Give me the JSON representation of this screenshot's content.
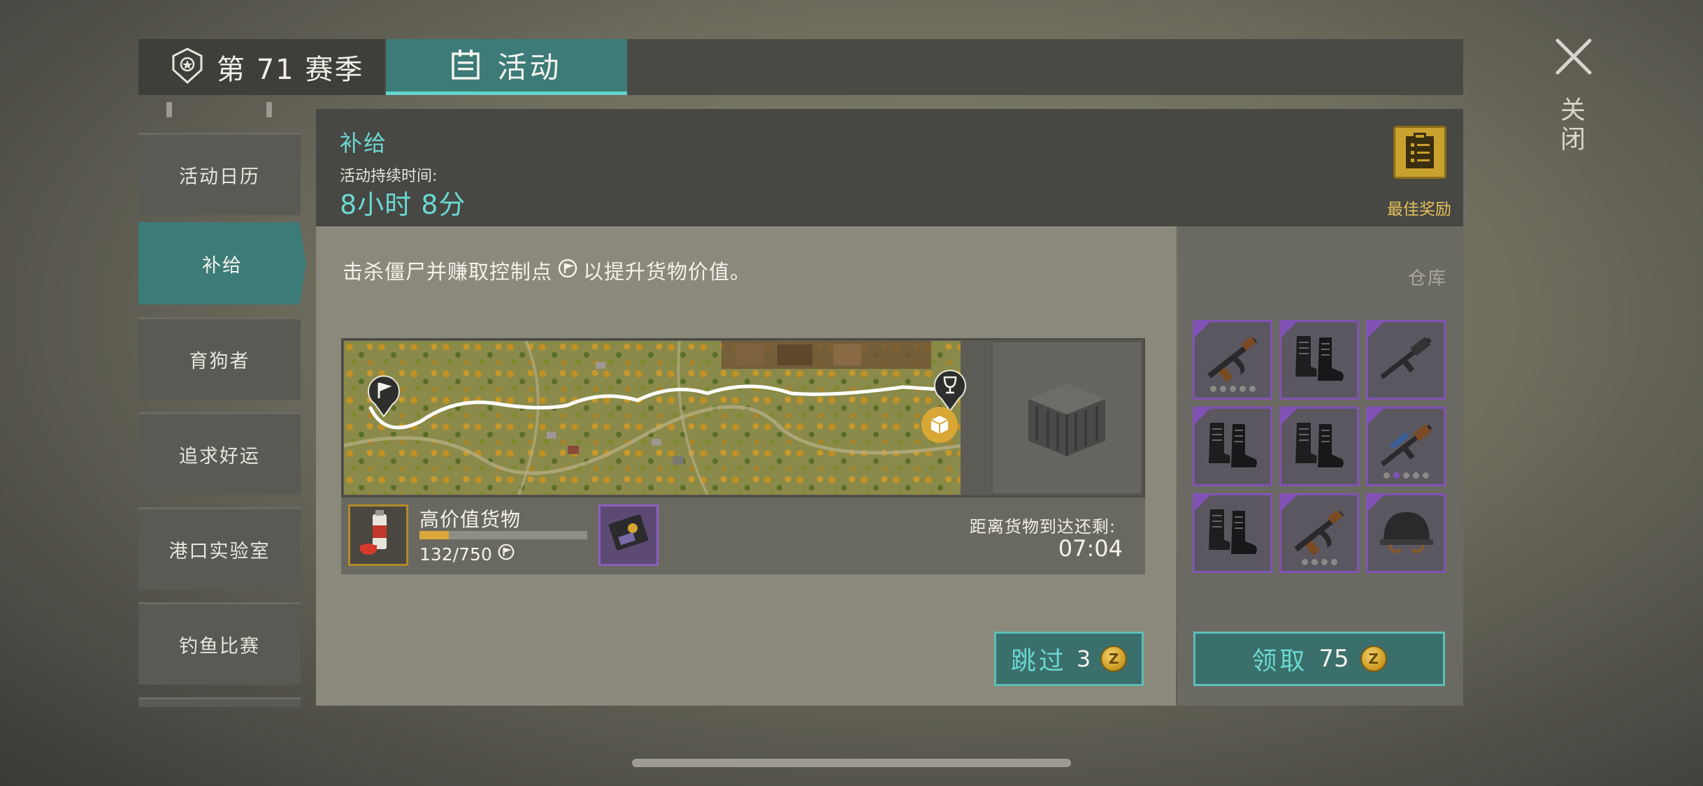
{
  "tabs": {
    "season_label": "第 71 赛季",
    "event_label": "活动"
  },
  "sidebar": {
    "items": [
      {
        "label": "活动日历"
      },
      {
        "label": "补给"
      },
      {
        "label": "育狗者"
      },
      {
        "label": "追求好运"
      },
      {
        "label": "港口实验室"
      },
      {
        "label": "钓鱼比赛"
      }
    ],
    "active_index": 1
  },
  "event": {
    "title": "补给",
    "duration_label": "活动持续时间:",
    "duration_value": "8小时 8分",
    "best_reward_label": "最佳奖励",
    "instruction_before": "击杀僵尸并赚取控制点",
    "instruction_after": "以提升货物价值。"
  },
  "cargo": {
    "title": "高价值货物",
    "progress_text": "132/750",
    "progress_value": 132,
    "progress_max": 750,
    "arrival_label": "距离货物到达还剩:",
    "arrival_time": "07:04"
  },
  "skip_button": {
    "label": "跳过",
    "cost": "3"
  },
  "warehouse": {
    "label": "仓库",
    "items": [
      {
        "icon": "assault-rifle-icon",
        "dots": [
          0,
          0,
          0,
          0,
          0
        ]
      },
      {
        "icon": "boots-icon"
      },
      {
        "icon": "rifle-icon"
      },
      {
        "icon": "boots-icon"
      },
      {
        "icon": "boots-icon"
      },
      {
        "icon": "scoped-rifle-icon",
        "dots": [
          0,
          1,
          0,
          0,
          0
        ]
      },
      {
        "icon": "boots-icon"
      },
      {
        "icon": "assault-rifle-icon",
        "dots": [
          0,
          0,
          0,
          0
        ]
      },
      {
        "icon": "helmet-icon"
      }
    ]
  },
  "claim_button": {
    "label": "领取",
    "cost": "75"
  },
  "close": {
    "label": "关闭"
  },
  "colors": {
    "accent_teal": "#3d7b78",
    "accent_teal_text": "#6ad8d1",
    "gold": "#c9a12f",
    "rarity_purple": "#8152b6"
  }
}
